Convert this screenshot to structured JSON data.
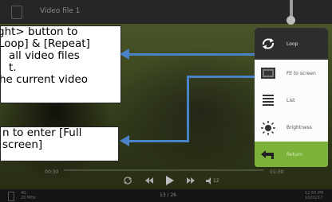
{
  "window": {
    "title": "Video file 1"
  },
  "callouts": {
    "first": {
      "lines": [
        "ght> button to",
        "Loop] & [Repeat]",
        " all video files",
        "t.",
        "he current video"
      ]
    },
    "second": {
      "lines": [
        "n to enter [Full",
        "screen]"
      ]
    }
  },
  "menu": {
    "items": [
      {
        "label": "Loop",
        "icon": "loop-icon"
      },
      {
        "label": "Fit to screen",
        "icon": "fit-to-screen-icon"
      },
      {
        "label": "List",
        "icon": "list-icon"
      },
      {
        "label": "Brightness",
        "icon": "brightness-icon"
      },
      {
        "label": "Return",
        "icon": "return-icon"
      }
    ]
  },
  "player": {
    "time_elapsed": "00:30",
    "time_total": "01:30",
    "volume": "12",
    "counter": "13 / 26"
  },
  "status": {
    "left_top": "4G",
    "left_bottom": "20 MHz",
    "right_top": "12:55 PM",
    "right_bottom": "10/01/17"
  },
  "colors": {
    "accent_blue": "#4a82c8",
    "return_green": "#7cb23a",
    "menu_active": "#2e2e2e"
  }
}
